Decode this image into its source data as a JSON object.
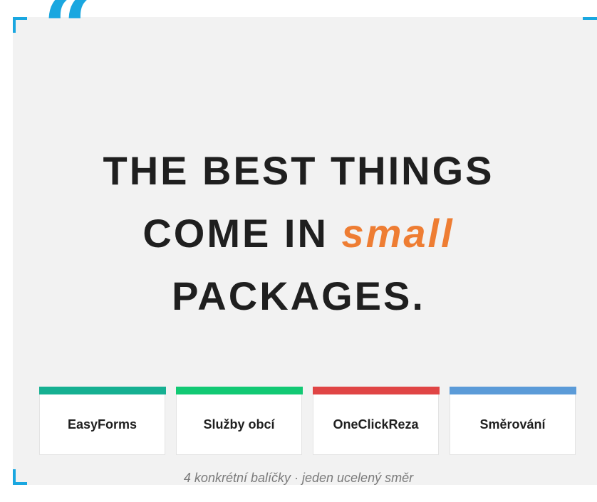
{
  "quote": {
    "mark": "“"
  },
  "headline": {
    "line1": "THE BEST THINGS",
    "line2_prefix": "COME IN",
    "line2_accent": "small",
    "line3": "PACKAGES."
  },
  "packages": [
    {
      "label": "EasyForms",
      "color": "#16b092"
    },
    {
      "label": "Služby obcí",
      "color": "#12c974"
    },
    {
      "label": "OneClickReza",
      "color": "#e04545"
    },
    {
      "label": "Směrování",
      "color": "#5b9bd8"
    }
  ],
  "caption": "4 konkrétní balíčky · jeden ucelený směr",
  "colors": {
    "accent_orange": "#ee7d33",
    "corner_blue": "#1aa7e0",
    "panel_bg": "#f2f2f2",
    "text_dark": "#1f1f1f"
  }
}
